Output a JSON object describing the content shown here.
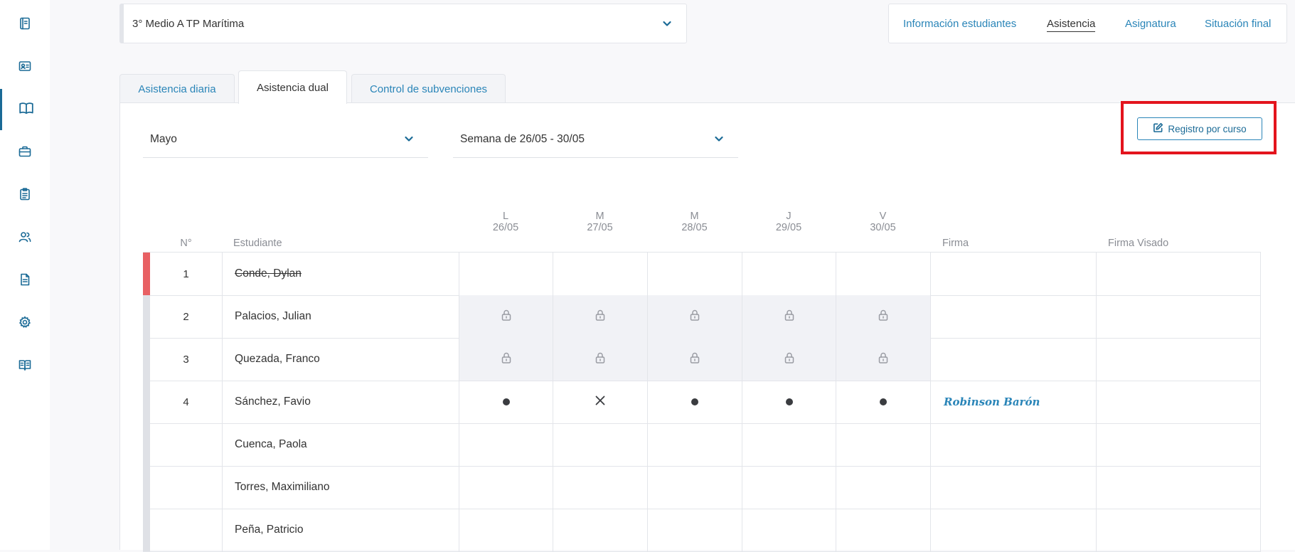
{
  "sidebar": {
    "items": [
      {
        "icon": "notebook-icon"
      },
      {
        "icon": "id-card-icon"
      },
      {
        "icon": "book-open-icon",
        "active": true
      },
      {
        "icon": "briefcase-icon"
      },
      {
        "icon": "clipboard-icon"
      },
      {
        "icon": "users-icon"
      },
      {
        "icon": "document-icon"
      },
      {
        "icon": "gear-icon"
      },
      {
        "icon": "book-icon"
      }
    ]
  },
  "course": {
    "selected": "3° Medio A TP Marítima"
  },
  "topnav": {
    "items": [
      "Información estudiantes",
      "Asistencia",
      "Asignatura",
      "Situación final"
    ],
    "active": "Asistencia"
  },
  "tabs": [
    "Asistencia diaria",
    "Asistencia dual",
    "Control de subvenciones"
  ],
  "active_tab": "Asistencia dual",
  "filters": {
    "month": "Mayo",
    "week": "Semana de 26/05 - 30/05"
  },
  "actions": {
    "register_button": "Registro por curso"
  },
  "table": {
    "headers": {
      "number": "N°",
      "student": "Estudiante",
      "signature": "Firma",
      "signature_visa": "Firma Visado"
    },
    "days": [
      {
        "letter": "L",
        "date": "26/05"
      },
      {
        "letter": "M",
        "date": "27/05"
      },
      {
        "letter": "M",
        "date": "28/05"
      },
      {
        "letter": "J",
        "date": "29/05"
      },
      {
        "letter": "V",
        "date": "30/05"
      }
    ],
    "rows": [
      {
        "number": "1",
        "name": "Conde, Dylan",
        "struck": true,
        "marker": "red",
        "days": [
          "",
          "",
          "",
          "",
          ""
        ],
        "signature": ""
      },
      {
        "number": "2",
        "name": "Palacios, Julian",
        "days": [
          "lock",
          "lock",
          "lock",
          "lock",
          "lock"
        ],
        "signature": ""
      },
      {
        "number": "3",
        "name": "Quezada, Franco",
        "days": [
          "lock",
          "lock",
          "lock",
          "lock",
          "lock"
        ],
        "signature": ""
      },
      {
        "number": "4",
        "name": "Sánchez, Favio",
        "days": [
          "present",
          "absent",
          "present",
          "present",
          "present"
        ],
        "signature": "Robinson Barón"
      },
      {
        "number": "",
        "name": "Cuenca, Paola",
        "days": [
          "",
          "",
          "",
          "",
          ""
        ],
        "signature": ""
      },
      {
        "number": "",
        "name": "Torres, Maximiliano",
        "days": [
          "",
          "",
          "",
          "",
          ""
        ],
        "signature": ""
      },
      {
        "number": "",
        "name": "Peña, Patricio",
        "days": [
          "",
          "",
          "",
          "",
          ""
        ],
        "signature": ""
      }
    ]
  },
  "colors": {
    "accent": "#2a85b8",
    "absence_marker": "#e86063",
    "highlight": "#e3141d"
  }
}
